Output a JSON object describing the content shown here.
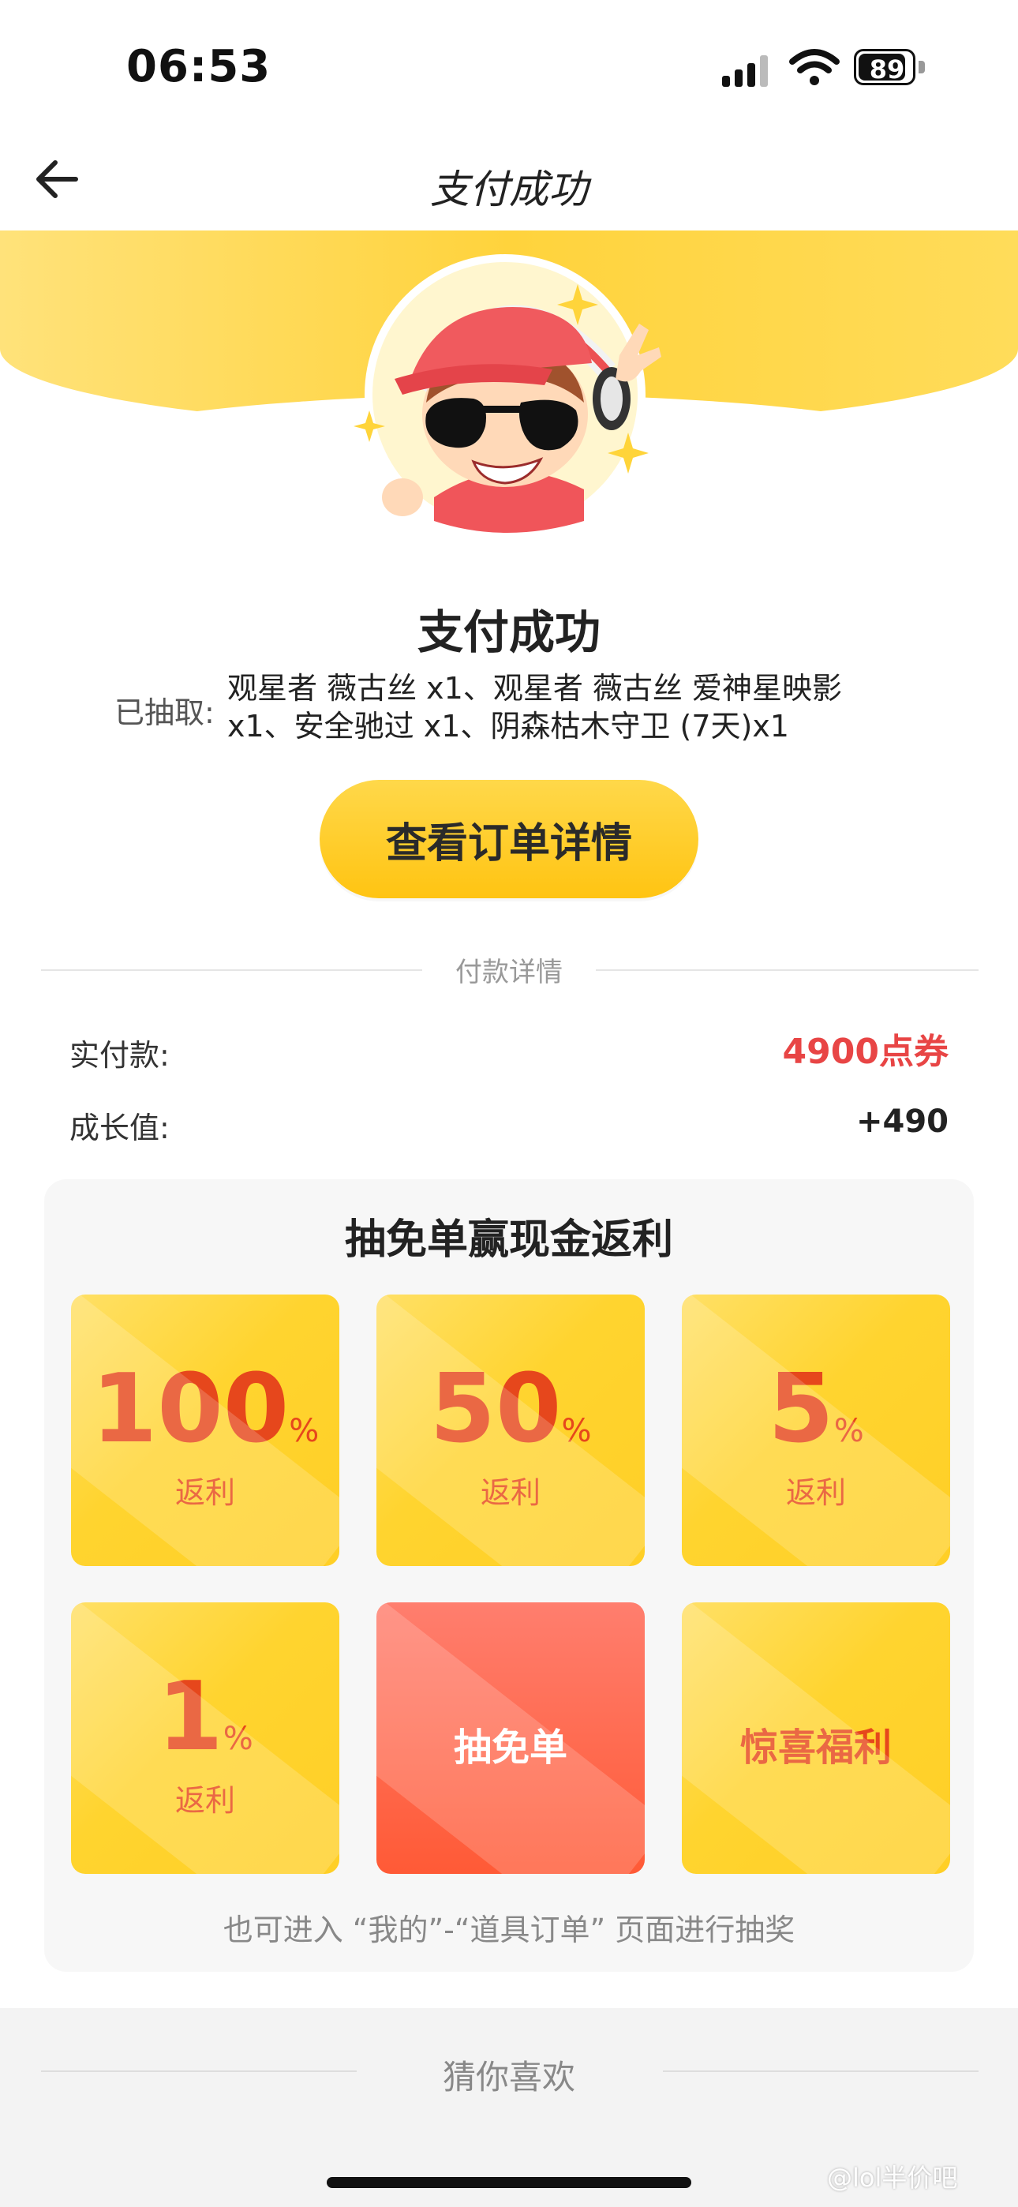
{
  "status_bar": {
    "time": "06:53",
    "battery": "89",
    "battery_level": 0.89
  },
  "nav": {
    "title": "支付成功"
  },
  "result": {
    "title": "支付成功",
    "drawn_label": "已抽取:",
    "drawn_items_line1": "观星者 薇古丝 x1、观星者 薇古丝 爱神星映影",
    "drawn_items_line2": "x1、安全驰过 x1、阴森枯木守卫 (7天)x1",
    "order_button": "查看订单详情"
  },
  "payment": {
    "section_label": "付款详情",
    "paid_label": "实付款:",
    "paid_value": "4900点券",
    "growth_label": "成长值:",
    "growth_value": "+490"
  },
  "cashback": {
    "title": "抽免单赢现金返利",
    "tiles": [
      {
        "value": "100",
        "unit": "%",
        "label": "返利"
      },
      {
        "value": "50",
        "unit": "%",
        "label": "返利"
      },
      {
        "value": "5",
        "unit": "%",
        "label": "返利"
      },
      {
        "value": "1",
        "unit": "%",
        "label": "返利"
      }
    ],
    "draw_button": "抽免单",
    "surprise": "惊喜福利",
    "hint": "也可进入 “我的”-“道具订单” 页面进行抽奖"
  },
  "recommend": {
    "label": "猜你喜欢"
  },
  "watermark": "@lol半价吧",
  "colors": {
    "accent_yellow": "#ffd33c",
    "price_red": "#e84545",
    "tile_text": "#e6471c",
    "draw_red": "#ff5a36"
  }
}
